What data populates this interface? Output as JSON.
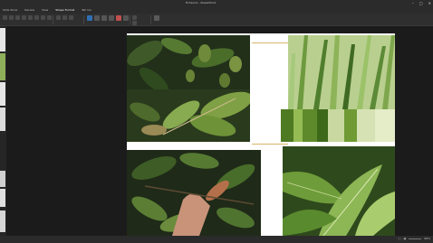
{
  "window": {
    "title": "Ficheiro1 - PowerPoint"
  },
  "menu": [
    "Slide Show",
    "Review",
    "View",
    "Shape Format",
    "Tell me"
  ],
  "status": {
    "zoom": "66%"
  },
  "icons": [
    "minimize-icon",
    "maximize-icon",
    "close-icon"
  ],
  "colors": {
    "app_bg": "#1b1b1b",
    "chrome": "#2b2b2b",
    "accent": "#d9b46a"
  }
}
